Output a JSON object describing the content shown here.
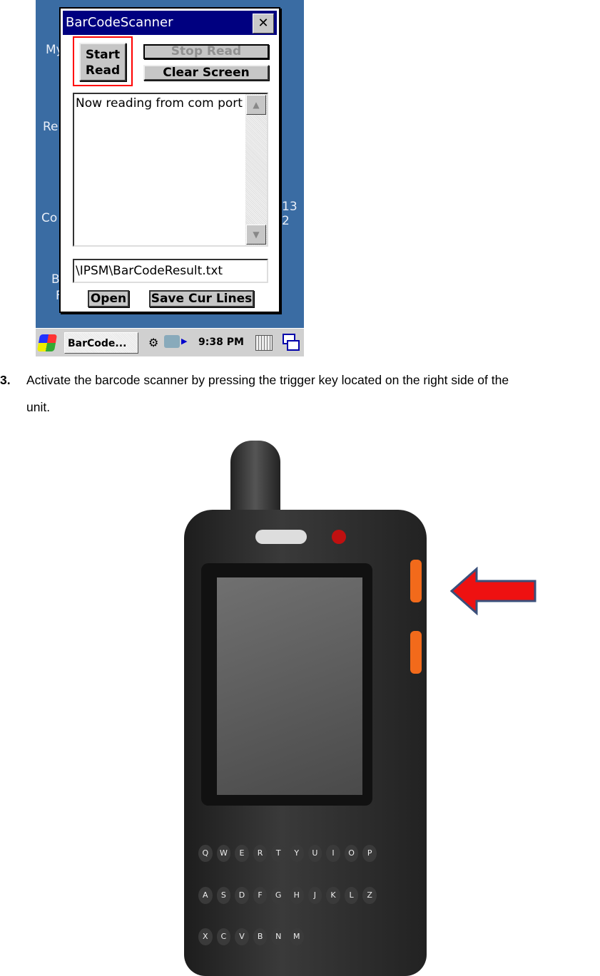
{
  "screenshot": {
    "desktop_icons": [
      "My",
      "Re",
      "Co",
      "B",
      "F",
      "13 2"
    ],
    "window": {
      "title": "BarCodeScanner",
      "close_label": "✕",
      "start_read": [
        "Start",
        "Read"
      ],
      "stop_read": "Stop Read",
      "clear_screen": "Clear Screen",
      "log_text": "Now reading from com port",
      "file_path": "\\IPSM\\BarCodeResult.txt",
      "open": "Open",
      "save_cur_lines": "Save Cur Lines"
    },
    "taskbar": {
      "task_button": "BarCode...",
      "clock": "9:38 PM"
    },
    "highlight_color": "#ff0000"
  },
  "step": {
    "number": "3.",
    "text_line1": "Activate the barcode scanner by pressing the trigger key located on the right side of the",
    "text_line2": "unit."
  },
  "photo": {
    "keys": [
      "Q",
      "W",
      "E",
      "R",
      "T",
      "Y",
      "U",
      "I",
      "O",
      "P",
      "A",
      "S",
      "D",
      "F",
      "G",
      "H",
      "J",
      "K",
      "L",
      "Z",
      "X",
      "C",
      "V",
      "B",
      "N",
      "M"
    ],
    "arrow_color": "#ee1111",
    "trigger_color": "#f26a1b"
  }
}
